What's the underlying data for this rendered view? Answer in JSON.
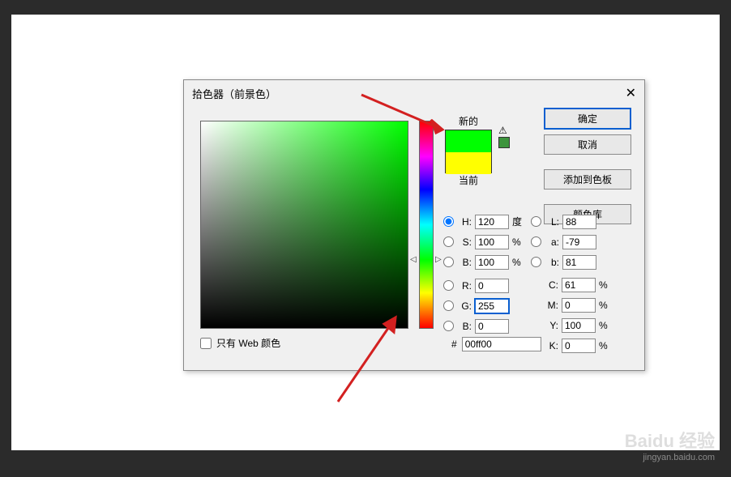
{
  "dialog": {
    "title": "拾色器（前景色）",
    "close": "✕",
    "new_label": "新的",
    "current_label": "当前",
    "warn": "⚠",
    "buttons": {
      "ok": "确定",
      "cancel": "取消",
      "add_swatch": "添加到色板",
      "color_libraries": "颜色库"
    },
    "web_only_label": "只有 Web 颜色",
    "hsb": {
      "h": "120",
      "h_unit": "度",
      "s": "100",
      "s_unit": "%",
      "b": "100",
      "b_unit": "%"
    },
    "rgb": {
      "r": "0",
      "g": "255",
      "b": "0"
    },
    "lab": {
      "l": "88",
      "a": "-79",
      "b": "81"
    },
    "cmyk": {
      "c": "61",
      "m": "0",
      "y": "100",
      "k": "0",
      "unit": "%"
    },
    "hex_label": "#",
    "hex": "00ff00",
    "labels": {
      "H": "H:",
      "S": "S:",
      "B": "B:",
      "R": "R:",
      "G": "G:",
      "Bb": "B:",
      "L": "L:",
      "a": "a:",
      "lb": "b:",
      "C": "C:",
      "M": "M:",
      "Y": "Y:",
      "K": "K:"
    }
  },
  "watermark": {
    "brand": "Baidu 经验",
    "sub": "jingyan.baidu.com"
  }
}
